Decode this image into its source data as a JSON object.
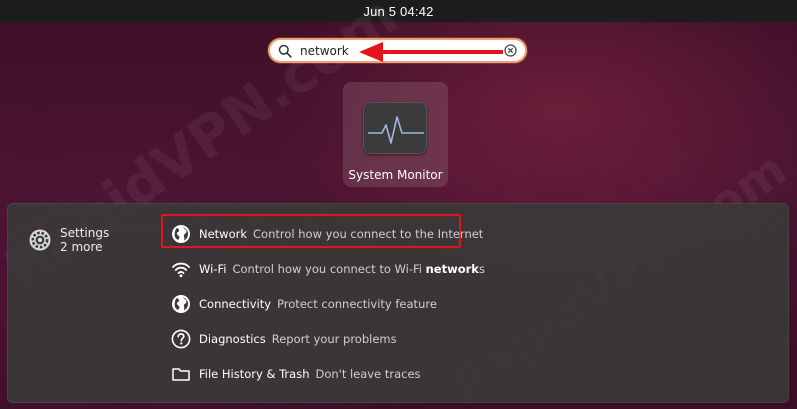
{
  "topbar": {
    "clock": "Jun 5  04:42"
  },
  "watermark": "RapidVPN.com",
  "search": {
    "value": "network",
    "icon": "search-icon",
    "clear_icon": "clear-icon"
  },
  "colors": {
    "accent": "#e95420",
    "annotation_red": "#e3151a",
    "panel": "#3a3a3a",
    "topbar": "#1d1d1d"
  },
  "app_grid": {
    "apps": [
      {
        "label": "System Monitor",
        "icon": "system-monitor-icon"
      }
    ]
  },
  "results": {
    "provider": {
      "name": "Settings",
      "more": "2 more",
      "icon": "settings-gear-icon"
    },
    "items": [
      {
        "title": "Network",
        "description": "Control how you connect to the Internet",
        "icon": "globe-icon"
      },
      {
        "title": "Wi-Fi",
        "description_prefix": "Control how you connect to Wi-Fi ",
        "description_bold": "network",
        "description_suffix": "s",
        "icon": "wifi-icon"
      },
      {
        "title": "Connectivity",
        "description": "Protect connectivity feature",
        "icon": "globe-icon"
      },
      {
        "title": "Diagnostics",
        "description": "Report your problems",
        "icon": "help-icon"
      },
      {
        "title": "File History & Trash",
        "description": "Don't leave traces",
        "icon": "folder-icon"
      }
    ]
  }
}
